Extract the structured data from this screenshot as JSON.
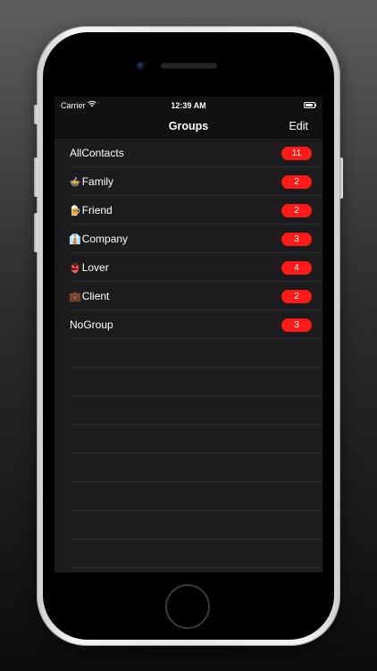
{
  "status_bar": {
    "carrier": "Carrier",
    "time": "12:39 AM"
  },
  "nav": {
    "title": "Groups",
    "edit_label": "Edit"
  },
  "groups": [
    {
      "icon": "",
      "icon_name": "",
      "name": "AllContacts",
      "count": "11"
    },
    {
      "icon": "🍲",
      "icon_name": "food-bowl-icon",
      "name": "Family",
      "count": "2"
    },
    {
      "icon": "🍺",
      "icon_name": "beer-mug-icon",
      "name": "Friend",
      "count": "2"
    },
    {
      "icon": "👔",
      "icon_name": "shirt-tie-icon",
      "name": "Company",
      "count": "3"
    },
    {
      "icon": "👙",
      "icon_name": "bikini-icon",
      "name": "Lover",
      "count": "4"
    },
    {
      "icon": "💼",
      "icon_name": "briefcase-icon",
      "name": "Client",
      "count": "2"
    },
    {
      "icon": "",
      "icon_name": "",
      "name": "NoGroup",
      "count": "3"
    }
  ],
  "colors": {
    "badge": "#ff1a1a",
    "list_background": "#1c1c1e",
    "separator": "#2a2a2c"
  }
}
